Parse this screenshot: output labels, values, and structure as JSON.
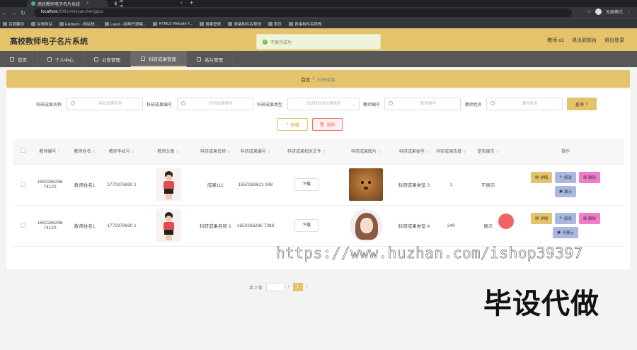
{
  "browser": {
    "tabs": [
      {
        "label": "高校教师电子名片系统",
        "active": true
      },
      {
        "label": "首页",
        "active": false
      }
    ],
    "url_host": "localhost",
    "url_path": ":8081/#/keyanchengguo",
    "profile_label": "无痕模式",
    "bookmarks": [
      "百度翻译",
      "在线网站",
      "Element - 网站快...",
      "Layui - 经典开源模...",
      "HTML5 Website T...",
      "搜索壁纸",
      "表格构件名称规",
      "首页",
      "表格构件名称规"
    ]
  },
  "header": {
    "title": "高校教师电子名片系统",
    "user": "教师 a1",
    "back_label": "退出到前台",
    "logout_label": "退出登录"
  },
  "toast": {
    "text": "不展示成功"
  },
  "menu": [
    {
      "label": "首页",
      "active": false
    },
    {
      "label": "个人中心",
      "active": false
    },
    {
      "label": "公告管理",
      "active": false
    },
    {
      "label": "科研成果管理",
      "active": true
    },
    {
      "label": "名片管理",
      "active": false
    }
  ],
  "breadcrumb": {
    "home": "首页",
    "separator": "/",
    "current": "科研成果"
  },
  "filters": [
    {
      "label": "科研成果名称",
      "placeholder": "科研成果名称"
    },
    {
      "label": "科研成果编号",
      "placeholder": "科研成果编号"
    },
    {
      "label": "科研成果类型",
      "placeholder": "请选择科研成果类型"
    },
    {
      "label": "教师编号",
      "placeholder": "教师编号"
    },
    {
      "label": "教师姓名",
      "placeholder": "教师姓名"
    }
  ],
  "actions": {
    "query": "查询",
    "add": "新增",
    "delete": "删除"
  },
  "table": {
    "headers": [
      "教师编号",
      "教师姓名",
      "教师手机号",
      "教师头像",
      "科研成果名称",
      "科研成果编号",
      "科研成果相关文件",
      "科研成果图片",
      "科研成果类型",
      "科研成果热度",
      "是否展示",
      "操作"
    ],
    "rows": [
      {
        "teacher_id": "1650266296 74120",
        "teacher_name": "教师姓名1",
        "phone": "1770378690 1",
        "result_name": "成果111",
        "result_id": "1650269621 948",
        "download": "下载",
        "result_type": "科研成果类型 3",
        "heat": "1",
        "display": "不展示",
        "ops": [
          "详情",
          "修改",
          "删除",
          "展示"
        ]
      },
      {
        "teacher_id": "1650266296 74120",
        "teacher_name": "教师姓名1",
        "phone": "1770378690 1",
        "result_name": "科研成果名称 3",
        "result_id": "1650266296 7288",
        "download": "下载",
        "result_type": "科研成果类型 4",
        "heat": "240",
        "display": "展示",
        "ops": [
          "详情",
          "修改",
          "删除",
          "不展示"
        ]
      }
    ]
  },
  "pager": {
    "total": "共 2 条",
    "page": "1"
  },
  "overlay": {
    "watermark": "https://www.huzhan.com/ishop39397",
    "promo": "毕设代做"
  }
}
